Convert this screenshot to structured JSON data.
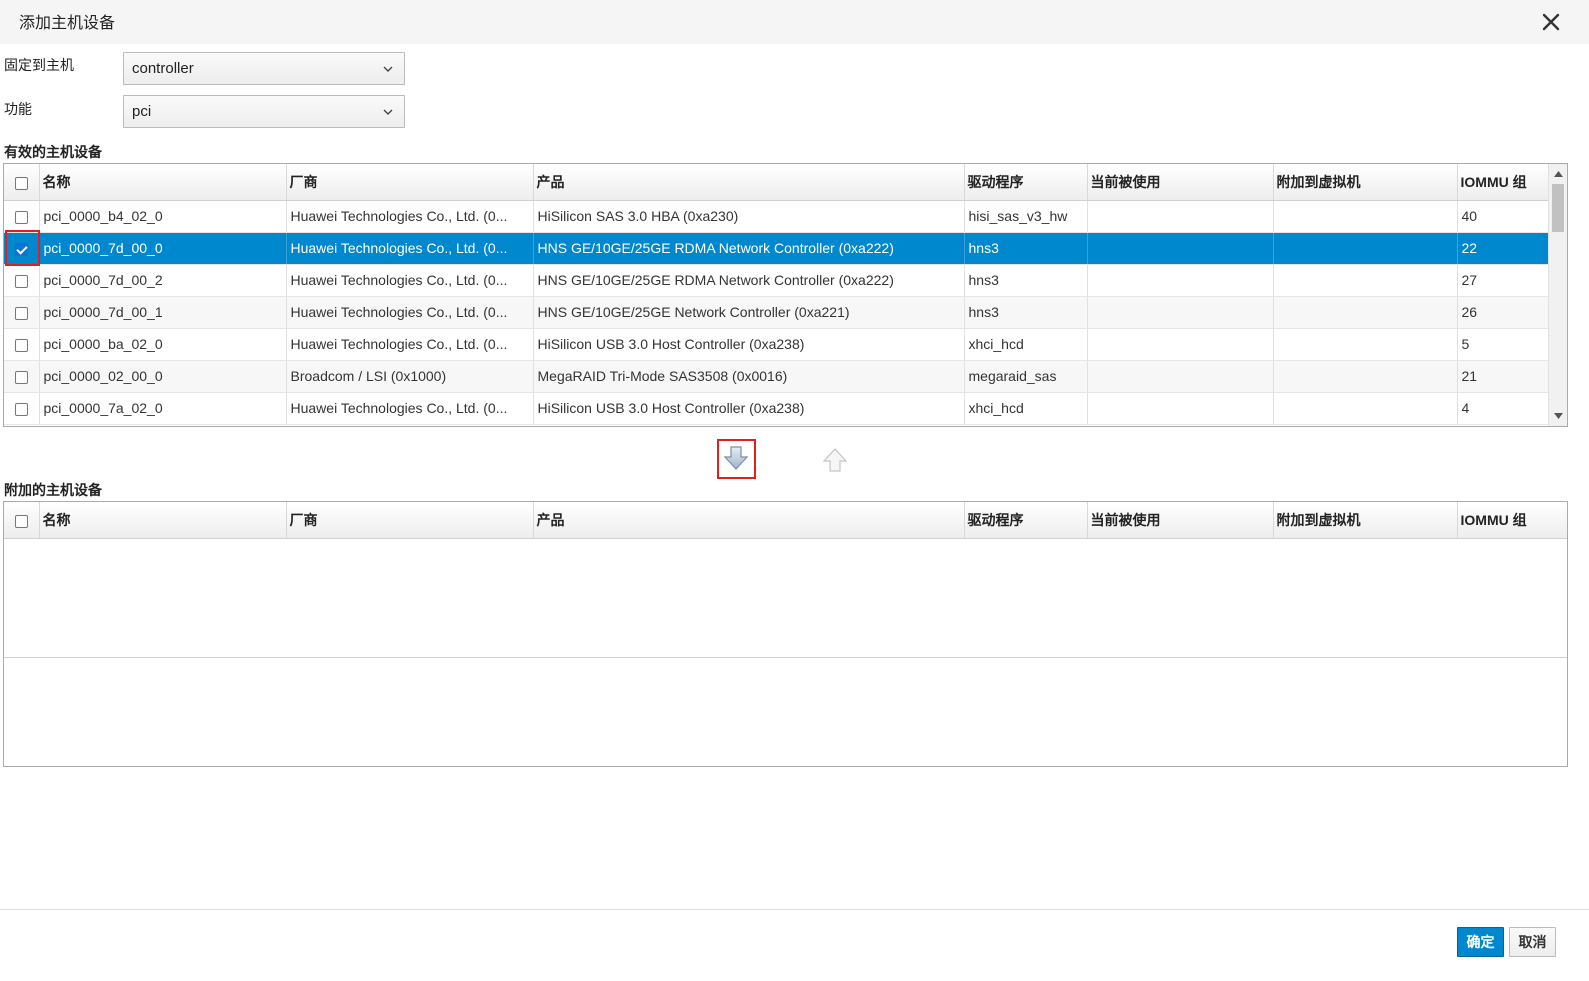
{
  "dialog": {
    "title": "添加主机设备",
    "close_icon": "close-icon"
  },
  "form": {
    "pin_to_host_label": "固定到主机",
    "pin_to_host_value": "controller",
    "capability_label": "功能",
    "capability_value": "pci"
  },
  "available": {
    "section_title": "有效的主机设备",
    "columns": [
      "名称",
      "厂商",
      "产品",
      "驱动程序",
      "当前被使用",
      "附加到虚拟机",
      "IOMMU 组"
    ],
    "rows": [
      {
        "name": "pci_0000_b4_02_0",
        "vendor": "Huawei Technologies Co., Ltd. (0...",
        "product": "HiSilicon SAS 3.0 HBA (0xa230)",
        "driver": "hisi_sas_v3_hw",
        "in_use": "",
        "attached_vm": "",
        "iommu": "40",
        "checked": false
      },
      {
        "name": "pci_0000_7d_00_0",
        "vendor": "Huawei Technologies Co., Ltd. (0...",
        "product": "HNS GE/10GE/25GE RDMA Network Controller (0xa222)",
        "driver": "hns3",
        "in_use": "",
        "attached_vm": "",
        "iommu": "22",
        "checked": true
      },
      {
        "name": "pci_0000_7d_00_2",
        "vendor": "Huawei Technologies Co., Ltd. (0...",
        "product": "HNS GE/10GE/25GE RDMA Network Controller (0xa222)",
        "driver": "hns3",
        "in_use": "",
        "attached_vm": "",
        "iommu": "27",
        "checked": false
      },
      {
        "name": "pci_0000_7d_00_1",
        "vendor": "Huawei Technologies Co., Ltd. (0...",
        "product": "HNS GE/10GE/25GE Network Controller (0xa221)",
        "driver": "hns3",
        "in_use": "",
        "attached_vm": "",
        "iommu": "26",
        "checked": false
      },
      {
        "name": "pci_0000_ba_02_0",
        "vendor": "Huawei Technologies Co., Ltd. (0...",
        "product": "HiSilicon USB 3.0 Host Controller (0xa238)",
        "driver": "xhci_hcd",
        "in_use": "",
        "attached_vm": "",
        "iommu": "5",
        "checked": false
      },
      {
        "name": "pci_0000_02_00_0",
        "vendor": "Broadcom / LSI (0x1000)",
        "product": "MegaRAID Tri-Mode SAS3508 (0x0016)",
        "driver": "megaraid_sas",
        "in_use": "",
        "attached_vm": "",
        "iommu": "21",
        "checked": false
      },
      {
        "name": "pci_0000_7a_02_0",
        "vendor": "Huawei Technologies Co., Ltd. (0...",
        "product": "HiSilicon USB 3.0 Host Controller (0xa238)",
        "driver": "xhci_hcd",
        "in_use": "",
        "attached_vm": "",
        "iommu": "4",
        "checked": false
      }
    ]
  },
  "attached": {
    "section_title": "附加的主机设备",
    "columns": [
      "名称",
      "厂商",
      "产品",
      "驱动程序",
      "当前被使用",
      "附加到虚拟机",
      "IOMMU 组"
    ]
  },
  "buttons": {
    "ok_label": "确定",
    "cancel_label": "取消",
    "move_down_icon": "arrow-down-icon",
    "move_up_icon": "arrow-up-icon"
  },
  "colors": {
    "selection": "#0088ce",
    "highlight": "#e02020"
  }
}
